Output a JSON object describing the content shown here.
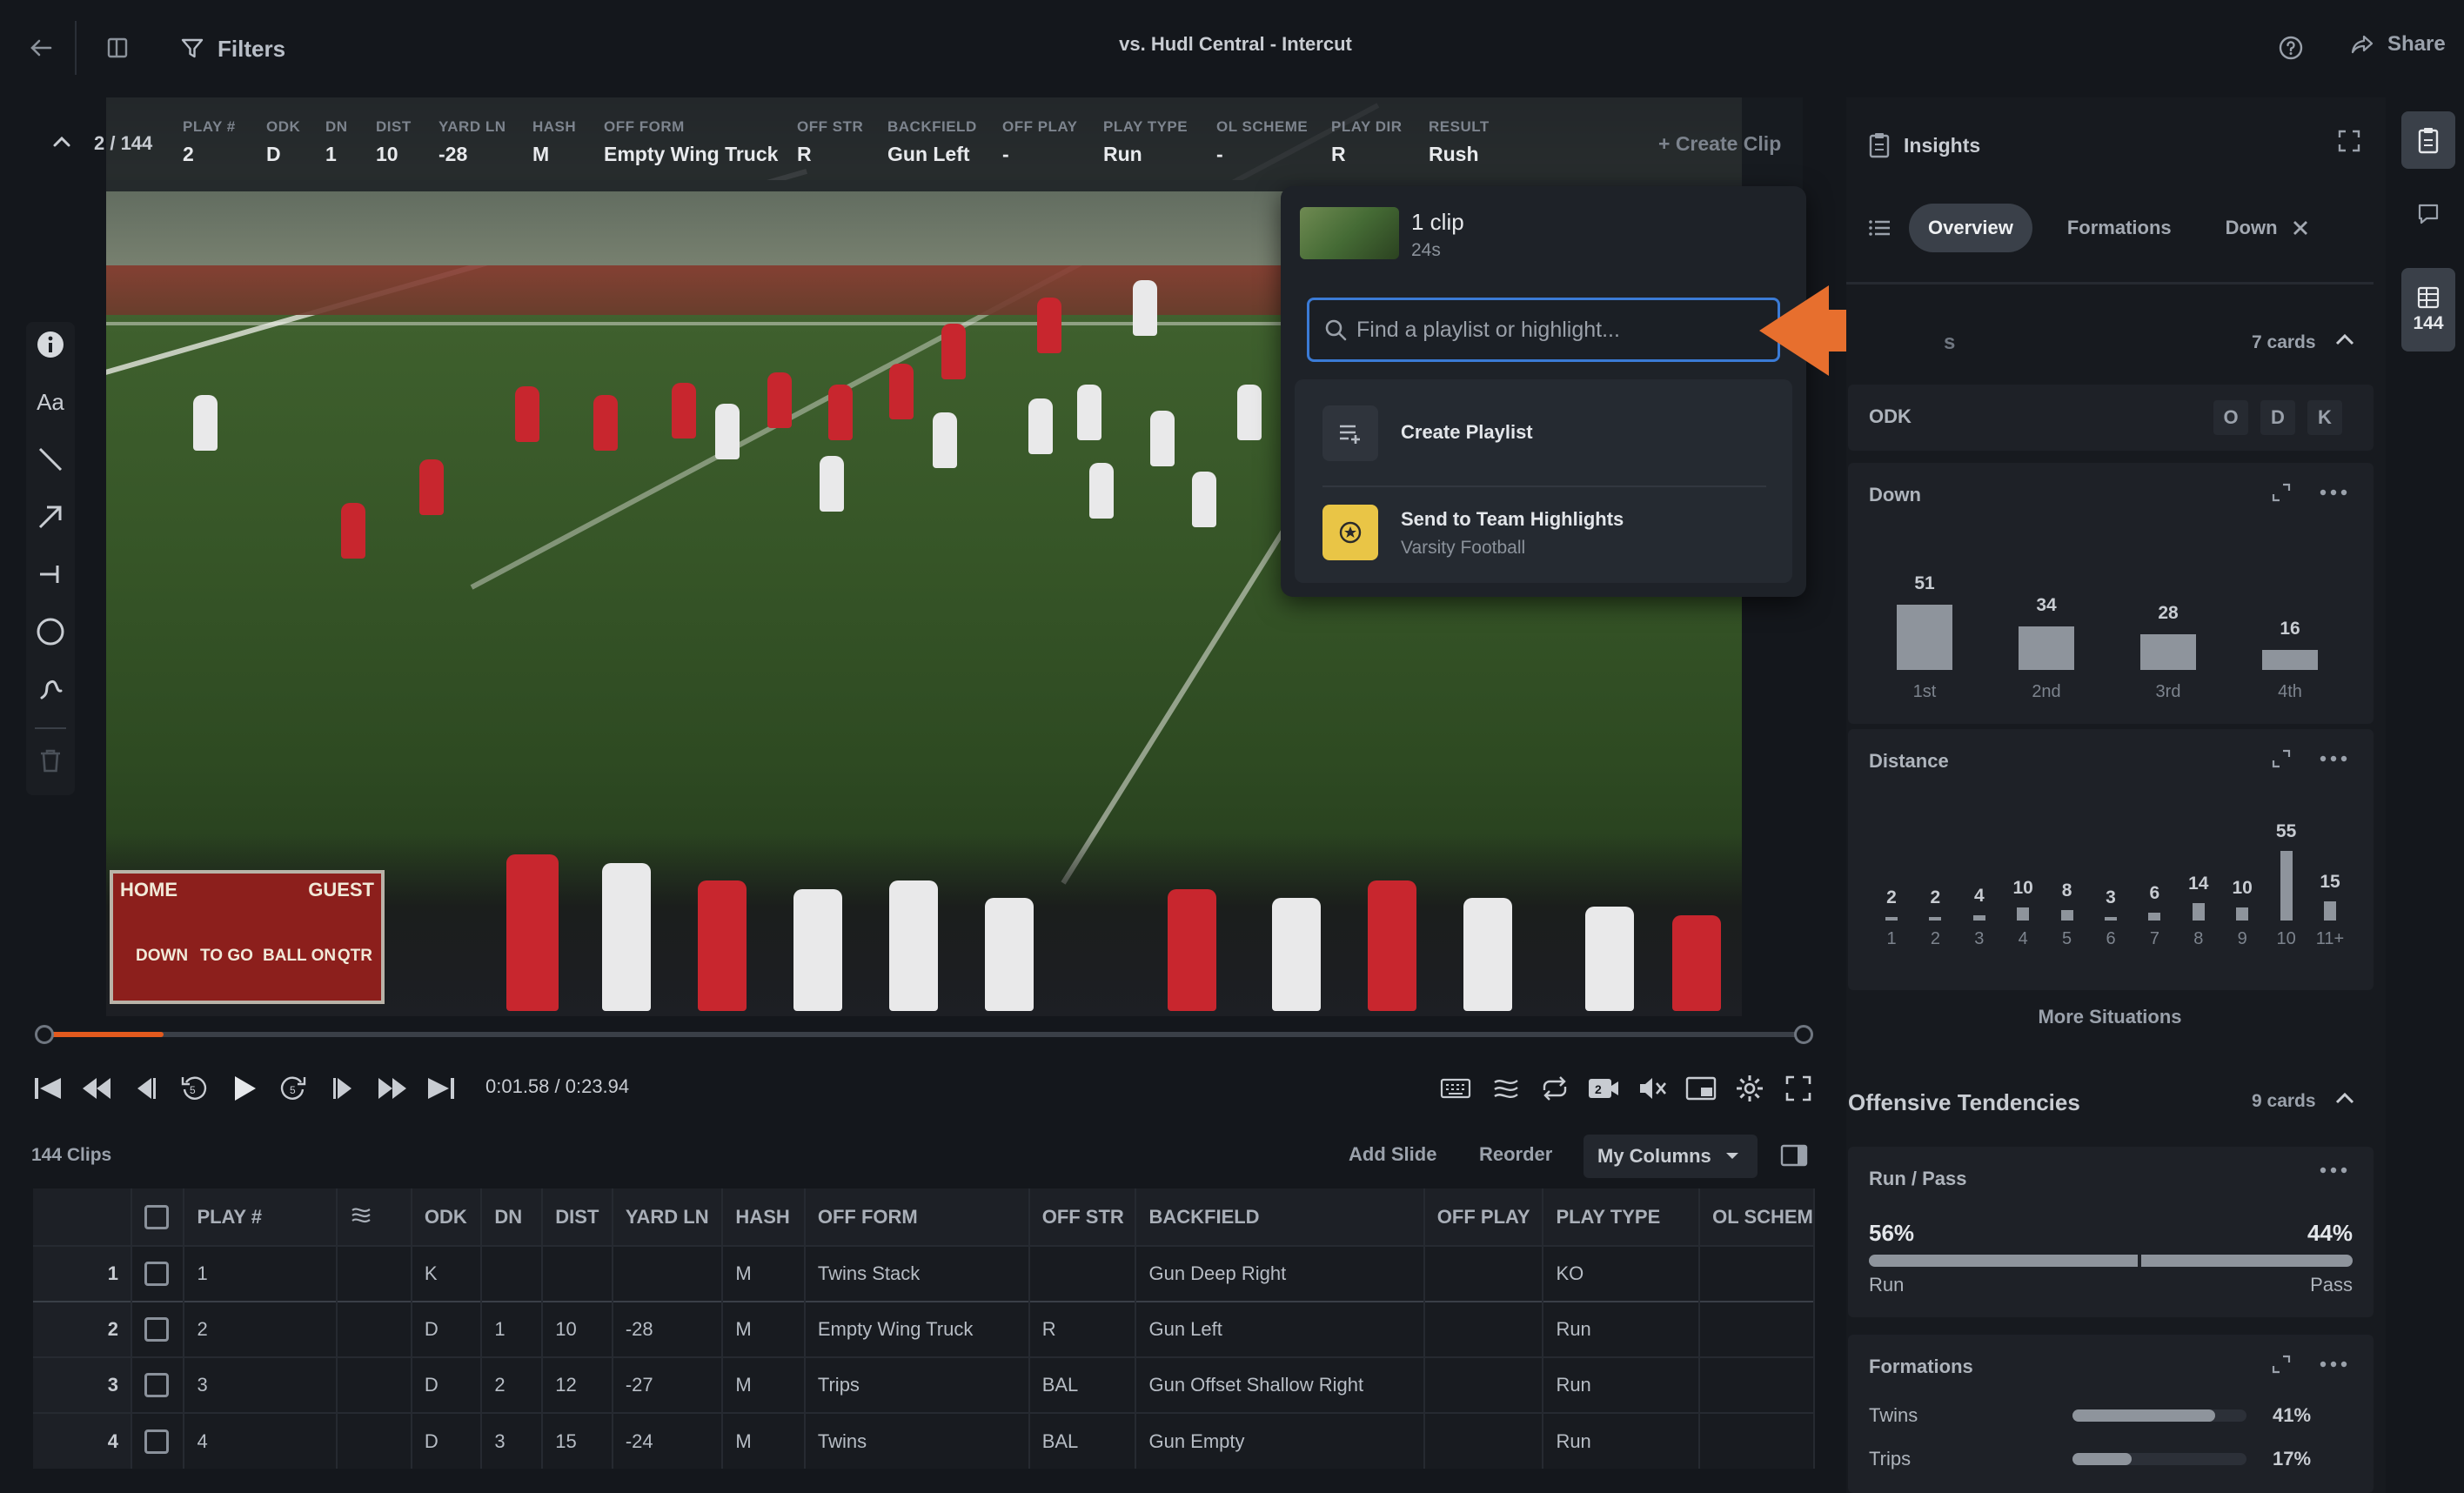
{
  "header": {
    "filters_label": "Filters",
    "title": "vs. Hudl Central - Intercut",
    "share_label": "Share"
  },
  "play_info": {
    "counter": "2 / 144",
    "fields": [
      {
        "h": "PLAY #",
        "v": "2"
      },
      {
        "h": "ODK",
        "v": "D"
      },
      {
        "h": "DN",
        "v": "1"
      },
      {
        "h": "DIST",
        "v": "10"
      },
      {
        "h": "YARD LN",
        "v": "-28"
      },
      {
        "h": "HASH",
        "v": "M"
      },
      {
        "h": "OFF FORM",
        "v": "Empty Wing Truck"
      },
      {
        "h": "OFF STR",
        "v": "R"
      },
      {
        "h": "BACKFIELD",
        "v": "Gun Left"
      },
      {
        "h": "OFF PLAY",
        "v": "-"
      },
      {
        "h": "PLAY TYPE",
        "v": "Run"
      },
      {
        "h": "OL SCHEME",
        "v": "-"
      },
      {
        "h": "PLAY DIR",
        "v": "R"
      },
      {
        "h": "RESULT",
        "v": "Rush"
      }
    ],
    "create_clip": "+ Create Clip"
  },
  "scoreboard": {
    "home": "HOME",
    "guest": "GUEST",
    "down": "DOWN",
    "to": "TO GO",
    "ball_on": "BALL ON",
    "qtr": "QTR"
  },
  "dropdown": {
    "clip_title": "1 clip",
    "clip_duration": "24s",
    "search_placeholder": "Find a playlist or highlight...",
    "create_playlist": "Create Playlist",
    "send_highlights": "Send to Team Highlights",
    "send_highlights_sub": "Varsity Football"
  },
  "player": {
    "progress": 0.068,
    "time": "0:01.58 / 0:23.94"
  },
  "table_toolbar": {
    "clips_count": "144 Clips",
    "add_slide": "Add Slide",
    "reorder": "Reorder",
    "my_columns": "My Columns"
  },
  "table": {
    "headers": [
      "",
      "",
      "PLAY #",
      "",
      "ODK",
      "DN",
      "DIST",
      "YARD LN",
      "HASH",
      "OFF FORM",
      "OFF STR",
      "BACKFIELD",
      "OFF PLAY",
      "PLAY TYPE",
      "OL SCHEM"
    ],
    "rows": [
      [
        "1",
        "",
        "1",
        "",
        "K",
        "",
        "",
        "",
        "M",
        "Twins Stack",
        "",
        "Gun Deep Right",
        "",
        "KO",
        ""
      ],
      [
        "2",
        "",
        "2",
        "",
        "D",
        "1",
        "10",
        "-28",
        "M",
        "Empty Wing Truck",
        "R",
        "Gun Left",
        "",
        "Run",
        ""
      ],
      [
        "3",
        "",
        "3",
        "",
        "D",
        "2",
        "12",
        "-27",
        "M",
        "Trips",
        "BAL",
        "Gun Offset Shallow Right",
        "",
        "Run",
        ""
      ],
      [
        "4",
        "",
        "4",
        "",
        "D",
        "3",
        "15",
        "-24",
        "M",
        "Twins",
        "BAL",
        "Gun Empty",
        "",
        "Run",
        ""
      ]
    ]
  },
  "sidebar": {
    "insights": "Insights",
    "tabs": [
      "Overview",
      "Formations",
      "Down"
    ],
    "situations_partial": "s",
    "situations_cards": "7 cards",
    "odk": {
      "title": "ODK",
      "buttons": [
        "O",
        "D",
        "K"
      ]
    },
    "down": {
      "title": "Down",
      "categories": [
        "1st",
        "2nd",
        "3rd",
        "4th"
      ],
      "values": [
        51,
        34,
        28,
        16
      ]
    },
    "distance": {
      "title": "Distance",
      "categories": [
        "1",
        "2",
        "3",
        "4",
        "5",
        "6",
        "7",
        "8",
        "9",
        "10",
        "11+"
      ],
      "values": [
        2,
        2,
        4,
        10,
        8,
        3,
        6,
        14,
        10,
        55,
        15
      ]
    },
    "more_situations": "More Situations",
    "offensive": {
      "title": "Offensive Tendencies",
      "cards": "9 cards"
    },
    "run_pass": {
      "title": "Run / Pass",
      "run_pct": "56%",
      "pass_pct": "44%",
      "run": "Run",
      "pass": "Pass",
      "run_value": 56
    },
    "formations": {
      "title": "Formations",
      "items": [
        {
          "name": "Twins",
          "pct": "41%",
          "value": 41
        },
        {
          "name": "Trips",
          "pct": "17%",
          "value": 17
        }
      ]
    }
  },
  "rail": {
    "count": "144"
  },
  "colors": {
    "accent_orange": "#e35a1e",
    "focus_blue": "#3b7bd6",
    "highlight_yellow": "#e9c546"
  }
}
